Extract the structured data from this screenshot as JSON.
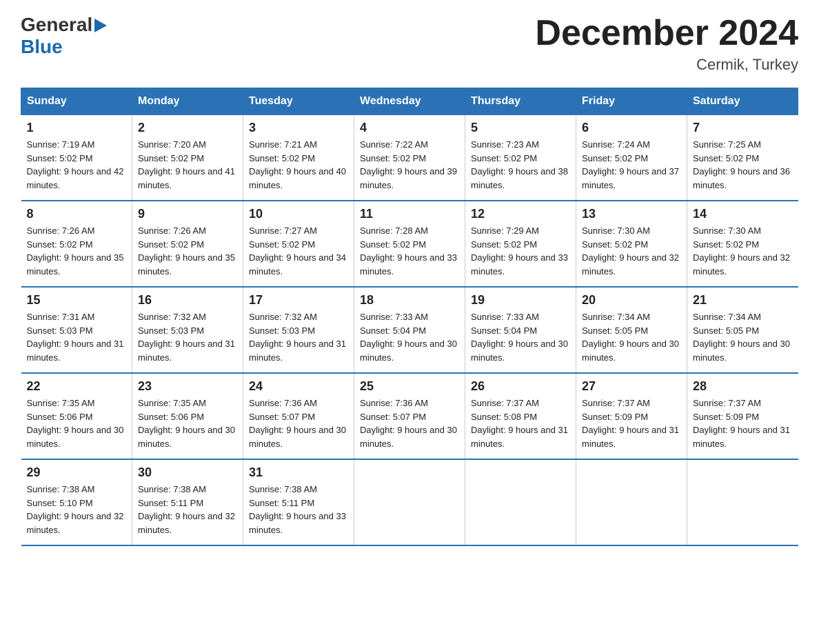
{
  "header": {
    "logo_line1": "General",
    "logo_triangle": "▶",
    "logo_line2": "Blue",
    "month_title": "December 2024",
    "location": "Cermik, Turkey"
  },
  "days_of_week": [
    "Sunday",
    "Monday",
    "Tuesday",
    "Wednesday",
    "Thursday",
    "Friday",
    "Saturday"
  ],
  "weeks": [
    [
      {
        "day": "1",
        "sunrise": "7:19 AM",
        "sunset": "5:02 PM",
        "daylight": "9 hours and 42 minutes."
      },
      {
        "day": "2",
        "sunrise": "7:20 AM",
        "sunset": "5:02 PM",
        "daylight": "9 hours and 41 minutes."
      },
      {
        "day": "3",
        "sunrise": "7:21 AM",
        "sunset": "5:02 PM",
        "daylight": "9 hours and 40 minutes."
      },
      {
        "day": "4",
        "sunrise": "7:22 AM",
        "sunset": "5:02 PM",
        "daylight": "9 hours and 39 minutes."
      },
      {
        "day": "5",
        "sunrise": "7:23 AM",
        "sunset": "5:02 PM",
        "daylight": "9 hours and 38 minutes."
      },
      {
        "day": "6",
        "sunrise": "7:24 AM",
        "sunset": "5:02 PM",
        "daylight": "9 hours and 37 minutes."
      },
      {
        "day": "7",
        "sunrise": "7:25 AM",
        "sunset": "5:02 PM",
        "daylight": "9 hours and 36 minutes."
      }
    ],
    [
      {
        "day": "8",
        "sunrise": "7:26 AM",
        "sunset": "5:02 PM",
        "daylight": "9 hours and 35 minutes."
      },
      {
        "day": "9",
        "sunrise": "7:26 AM",
        "sunset": "5:02 PM",
        "daylight": "9 hours and 35 minutes."
      },
      {
        "day": "10",
        "sunrise": "7:27 AM",
        "sunset": "5:02 PM",
        "daylight": "9 hours and 34 minutes."
      },
      {
        "day": "11",
        "sunrise": "7:28 AM",
        "sunset": "5:02 PM",
        "daylight": "9 hours and 33 minutes."
      },
      {
        "day": "12",
        "sunrise": "7:29 AM",
        "sunset": "5:02 PM",
        "daylight": "9 hours and 33 minutes."
      },
      {
        "day": "13",
        "sunrise": "7:30 AM",
        "sunset": "5:02 PM",
        "daylight": "9 hours and 32 minutes."
      },
      {
        "day": "14",
        "sunrise": "7:30 AM",
        "sunset": "5:02 PM",
        "daylight": "9 hours and 32 minutes."
      }
    ],
    [
      {
        "day": "15",
        "sunrise": "7:31 AM",
        "sunset": "5:03 PM",
        "daylight": "9 hours and 31 minutes."
      },
      {
        "day": "16",
        "sunrise": "7:32 AM",
        "sunset": "5:03 PM",
        "daylight": "9 hours and 31 minutes."
      },
      {
        "day": "17",
        "sunrise": "7:32 AM",
        "sunset": "5:03 PM",
        "daylight": "9 hours and 31 minutes."
      },
      {
        "day": "18",
        "sunrise": "7:33 AM",
        "sunset": "5:04 PM",
        "daylight": "9 hours and 30 minutes."
      },
      {
        "day": "19",
        "sunrise": "7:33 AM",
        "sunset": "5:04 PM",
        "daylight": "9 hours and 30 minutes."
      },
      {
        "day": "20",
        "sunrise": "7:34 AM",
        "sunset": "5:05 PM",
        "daylight": "9 hours and 30 minutes."
      },
      {
        "day": "21",
        "sunrise": "7:34 AM",
        "sunset": "5:05 PM",
        "daylight": "9 hours and 30 minutes."
      }
    ],
    [
      {
        "day": "22",
        "sunrise": "7:35 AM",
        "sunset": "5:06 PM",
        "daylight": "9 hours and 30 minutes."
      },
      {
        "day": "23",
        "sunrise": "7:35 AM",
        "sunset": "5:06 PM",
        "daylight": "9 hours and 30 minutes."
      },
      {
        "day": "24",
        "sunrise": "7:36 AM",
        "sunset": "5:07 PM",
        "daylight": "9 hours and 30 minutes."
      },
      {
        "day": "25",
        "sunrise": "7:36 AM",
        "sunset": "5:07 PM",
        "daylight": "9 hours and 30 minutes."
      },
      {
        "day": "26",
        "sunrise": "7:37 AM",
        "sunset": "5:08 PM",
        "daylight": "9 hours and 31 minutes."
      },
      {
        "day": "27",
        "sunrise": "7:37 AM",
        "sunset": "5:09 PM",
        "daylight": "9 hours and 31 minutes."
      },
      {
        "day": "28",
        "sunrise": "7:37 AM",
        "sunset": "5:09 PM",
        "daylight": "9 hours and 31 minutes."
      }
    ],
    [
      {
        "day": "29",
        "sunrise": "7:38 AM",
        "sunset": "5:10 PM",
        "daylight": "9 hours and 32 minutes."
      },
      {
        "day": "30",
        "sunrise": "7:38 AM",
        "sunset": "5:11 PM",
        "daylight": "9 hours and 32 minutes."
      },
      {
        "day": "31",
        "sunrise": "7:38 AM",
        "sunset": "5:11 PM",
        "daylight": "9 hours and 33 minutes."
      },
      {
        "day": "",
        "sunrise": "",
        "sunset": "",
        "daylight": ""
      },
      {
        "day": "",
        "sunrise": "",
        "sunset": "",
        "daylight": ""
      },
      {
        "day": "",
        "sunrise": "",
        "sunset": "",
        "daylight": ""
      },
      {
        "day": "",
        "sunrise": "",
        "sunset": "",
        "daylight": ""
      }
    ]
  ]
}
